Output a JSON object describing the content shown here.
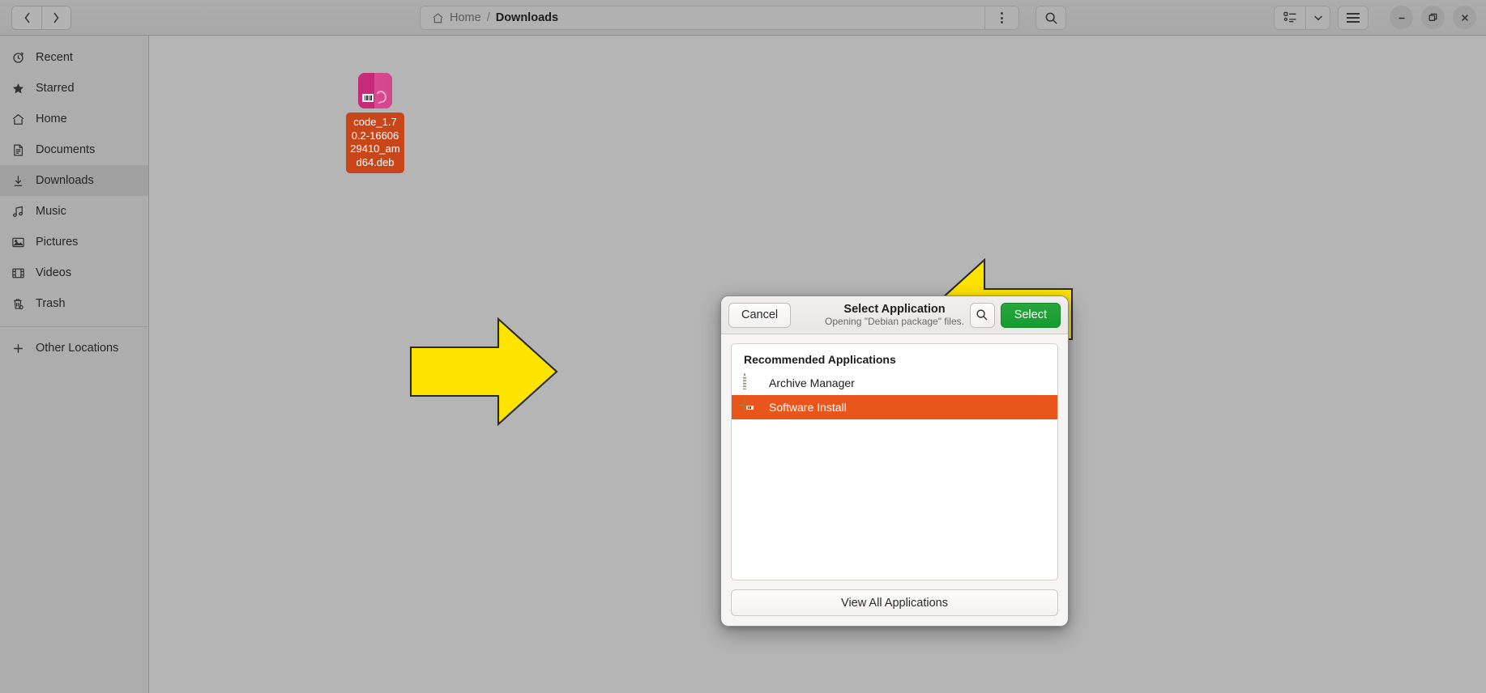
{
  "window": {
    "titlebar": {
      "nav_back": "‹",
      "nav_forward": "›",
      "breadcrumb": {
        "home": "Home",
        "separator": "/",
        "current": "Downloads"
      },
      "path_menu_icon": "vertical-dots-icon",
      "search_icon": "search-icon",
      "view_list_icon": "list-view-icon",
      "view_dropdown_icon": "chevron-down-icon",
      "menu_icon": "hamburger-menu-icon",
      "minimize": "—",
      "maximize": "❐",
      "close": "✕"
    }
  },
  "sidebar": {
    "items": [
      {
        "label": "Recent",
        "icon": "clock-icon",
        "active": false
      },
      {
        "label": "Starred",
        "icon": "star-icon",
        "active": false
      },
      {
        "label": "Home",
        "icon": "home-icon",
        "active": false
      },
      {
        "label": "Documents",
        "icon": "document-icon",
        "active": false
      },
      {
        "label": "Downloads",
        "icon": "download-icon",
        "active": true
      },
      {
        "label": "Music",
        "icon": "music-icon",
        "active": false
      },
      {
        "label": "Pictures",
        "icon": "image-icon",
        "active": false
      },
      {
        "label": "Videos",
        "icon": "film-icon",
        "active": false
      },
      {
        "label": "Trash",
        "icon": "trash-icon",
        "active": false
      }
    ],
    "other_locations": {
      "label": "Other Locations",
      "icon": "plus-icon"
    }
  },
  "file_area": {
    "files": [
      {
        "name": "code_1.70.2-1660629410_amd64.deb",
        "icon": "debian-package-icon",
        "selected": true
      }
    ]
  },
  "dialog": {
    "cancel_label": "Cancel",
    "title": "Select Application",
    "subtitle": "Opening \"Debian package\" files.",
    "search_icon": "search-icon",
    "select_label": "Select",
    "list_header": "Recommended Applications",
    "applications": [
      {
        "label": "Archive Manager",
        "icon": "archive-zip-icon",
        "selected": false
      },
      {
        "label": "Software Install",
        "icon": "package-box-icon",
        "selected": true
      }
    ],
    "view_all_label": "View All Applications"
  },
  "annotations": {
    "arrows": [
      {
        "name": "arrow-pointing-to-dialog-list",
        "direction": "right",
        "color": "#FFE400"
      },
      {
        "name": "arrow-pointing-to-select-button",
        "direction": "left",
        "color": "#FFE400"
      }
    ]
  },
  "colors": {
    "accent_selection": "#e8561c",
    "select_button": "#169b2f",
    "file_label": "#c9461a",
    "arrow_yellow": "#FFE400",
    "window_bg": "#b4b4b4"
  }
}
